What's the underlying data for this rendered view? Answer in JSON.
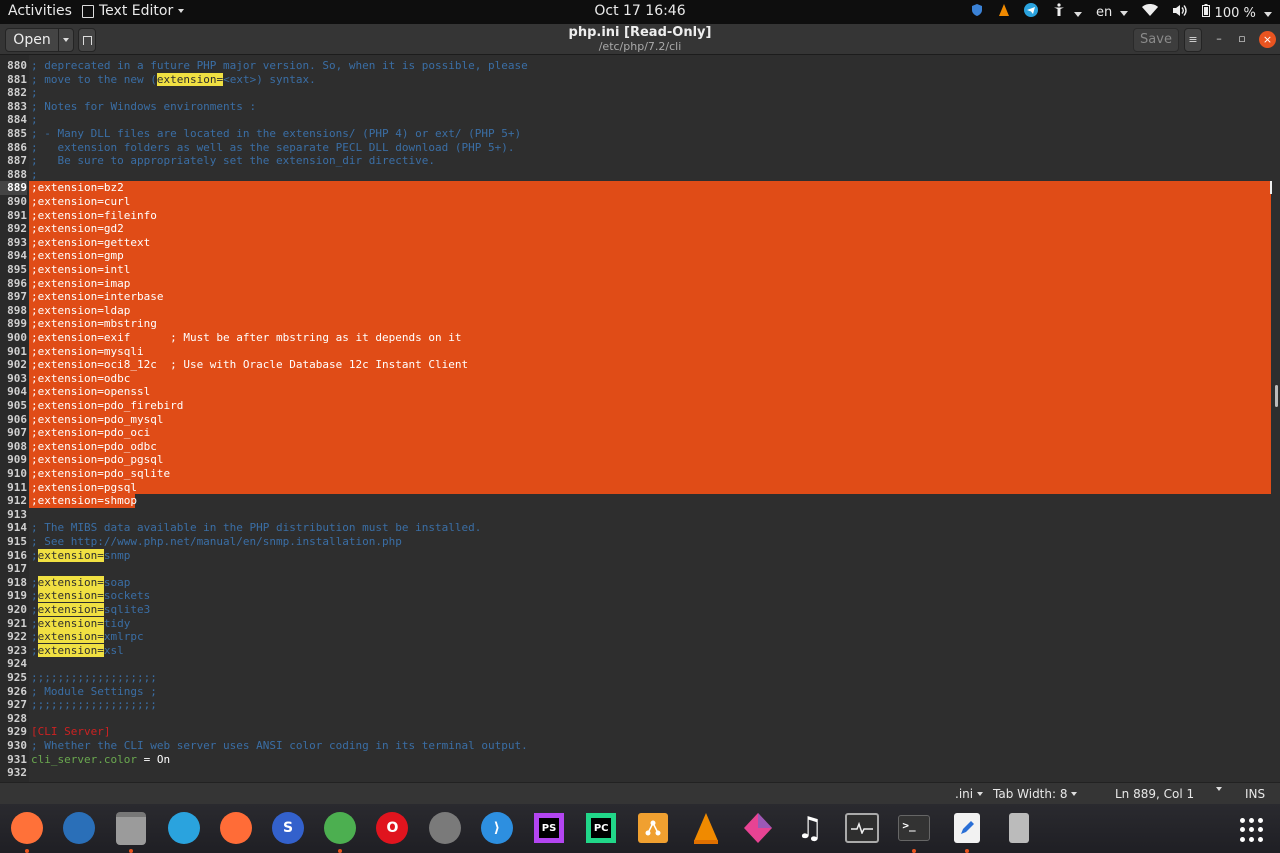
{
  "topbar": {
    "activities": "Activities",
    "app_menu": "Text Editor",
    "clock": "Oct 17  16:46",
    "language": "en",
    "battery": "100 %"
  },
  "header": {
    "open_label": "Open",
    "title": "php.ini [Read-Only]",
    "subtitle": "/etc/php/7.2/cli",
    "save_label": "Save"
  },
  "editor": {
    "lines": [
      {
        "num": "880",
        "parts": [
          {
            "t": "; deprecated in a future PHP major version. So, when it is possible, please"
          }
        ]
      },
      {
        "num": "881",
        "parts": [
          {
            "t": "; move to the new ("
          },
          {
            "t": "extension=",
            "hl": true
          },
          {
            "t": "<ext>) syntax."
          }
        ]
      },
      {
        "num": "882",
        "parts": [
          {
            "t": ";"
          }
        ]
      },
      {
        "num": "883",
        "parts": [
          {
            "t": "; Notes for Windows environments :"
          }
        ]
      },
      {
        "num": "884",
        "parts": [
          {
            "t": ";"
          }
        ]
      },
      {
        "num": "885",
        "parts": [
          {
            "t": "; - Many DLL files are located in the extensions/ (PHP 4) or ext/ (PHP 5+)"
          }
        ]
      },
      {
        "num": "886",
        "parts": [
          {
            "t": ";   extension folders as well as the separate PECL DLL download (PHP 5+)."
          }
        ]
      },
      {
        "num": "887",
        "parts": [
          {
            "t": ";   Be sure to appropriately set the extension_dir directive."
          }
        ]
      },
      {
        "num": "888",
        "parts": [
          {
            "t": ";"
          }
        ]
      },
      {
        "num": "889",
        "sel": true,
        "current": true,
        "parts": [
          {
            "t": ";extension=bz2"
          }
        ]
      },
      {
        "num": "890",
        "sel": true,
        "parts": [
          {
            "t": ";extension=curl"
          }
        ]
      },
      {
        "num": "891",
        "sel": true,
        "parts": [
          {
            "t": ";extension=fileinfo"
          }
        ]
      },
      {
        "num": "892",
        "sel": true,
        "parts": [
          {
            "t": ";extension=gd2"
          }
        ]
      },
      {
        "num": "893",
        "sel": true,
        "parts": [
          {
            "t": ";extension=gettext"
          }
        ]
      },
      {
        "num": "894",
        "sel": true,
        "parts": [
          {
            "t": ";extension=gmp"
          }
        ]
      },
      {
        "num": "895",
        "sel": true,
        "parts": [
          {
            "t": ";extension=intl"
          }
        ]
      },
      {
        "num": "896",
        "sel": true,
        "parts": [
          {
            "t": ";extension=imap"
          }
        ]
      },
      {
        "num": "897",
        "sel": true,
        "parts": [
          {
            "t": ";extension=interbase"
          }
        ]
      },
      {
        "num": "898",
        "sel": true,
        "parts": [
          {
            "t": ";extension=ldap"
          }
        ]
      },
      {
        "num": "899",
        "sel": true,
        "parts": [
          {
            "t": ";extension=mbstring"
          }
        ]
      },
      {
        "num": "900",
        "sel": true,
        "parts": [
          {
            "t": ";extension=exif      ; Must be after mbstring as it depends on it"
          }
        ]
      },
      {
        "num": "901",
        "sel": true,
        "parts": [
          {
            "t": ";extension=mysqli"
          }
        ]
      },
      {
        "num": "902",
        "sel": true,
        "parts": [
          {
            "t": ";extension=oci8_12c  ; Use with Oracle Database 12c Instant Client"
          }
        ]
      },
      {
        "num": "903",
        "sel": true,
        "parts": [
          {
            "t": ";extension=odbc"
          }
        ]
      },
      {
        "num": "904",
        "sel": true,
        "parts": [
          {
            "t": ";extension=openssl"
          }
        ]
      },
      {
        "num": "905",
        "sel": true,
        "parts": [
          {
            "t": ";extension=pdo_firebird"
          }
        ]
      },
      {
        "num": "906",
        "sel": true,
        "parts": [
          {
            "t": ";extension=pdo_mysql"
          }
        ]
      },
      {
        "num": "907",
        "sel": true,
        "parts": [
          {
            "t": ";extension=pdo_oci"
          }
        ]
      },
      {
        "num": "908",
        "sel": true,
        "parts": [
          {
            "t": ";extension=pdo_odbc"
          }
        ]
      },
      {
        "num": "909",
        "sel": true,
        "parts": [
          {
            "t": ";extension=pdo_pgsql"
          }
        ]
      },
      {
        "num": "910",
        "sel": true,
        "parts": [
          {
            "t": ";extension=pdo_sqlite"
          }
        ]
      },
      {
        "num": "911",
        "sel": true,
        "parts": [
          {
            "t": ";extension=pgsql"
          }
        ]
      },
      {
        "num": "912",
        "sel": true,
        "parts": [
          {
            "t": ";extension=shmop"
          }
        ]
      },
      {
        "num": "913",
        "parts": [
          {
            "t": ""
          }
        ]
      },
      {
        "num": "914",
        "parts": [
          {
            "t": "; The MIBS data available in the PHP distribution must be installed."
          }
        ]
      },
      {
        "num": "915",
        "parts": [
          {
            "t": "; See http://www.php.net/manual/en/snmp.installation.php"
          }
        ]
      },
      {
        "num": "916",
        "parts": [
          {
            "t": ";"
          },
          {
            "t": "extension=",
            "hl": true
          },
          {
            "t": "snmp"
          }
        ]
      },
      {
        "num": "917",
        "parts": [
          {
            "t": ""
          }
        ]
      },
      {
        "num": "918",
        "parts": [
          {
            "t": ";"
          },
          {
            "t": "extension=",
            "hl": true
          },
          {
            "t": "soap"
          }
        ]
      },
      {
        "num": "919",
        "parts": [
          {
            "t": ";"
          },
          {
            "t": "extension=",
            "hl": true
          },
          {
            "t": "sockets"
          }
        ]
      },
      {
        "num": "920",
        "parts": [
          {
            "t": ";"
          },
          {
            "t": "extension=",
            "hl": true
          },
          {
            "t": "sqlite3"
          }
        ]
      },
      {
        "num": "921",
        "parts": [
          {
            "t": ";"
          },
          {
            "t": "extension=",
            "hl": true
          },
          {
            "t": "tidy"
          }
        ]
      },
      {
        "num": "922",
        "parts": [
          {
            "t": ";"
          },
          {
            "t": "extension=",
            "hl": true
          },
          {
            "t": "xmlrpc"
          }
        ]
      },
      {
        "num": "923",
        "parts": [
          {
            "t": ";"
          },
          {
            "t": "extension=",
            "hl": true
          },
          {
            "t": "xsl"
          }
        ]
      },
      {
        "num": "924",
        "parts": [
          {
            "t": ""
          }
        ]
      },
      {
        "num": "925",
        "parts": [
          {
            "t": ";;;;;;;;;;;;;;;;;;;"
          }
        ]
      },
      {
        "num": "926",
        "parts": [
          {
            "t": "; Module Settings ;"
          }
        ]
      },
      {
        "num": "927",
        "parts": [
          {
            "t": ";;;;;;;;;;;;;;;;;;;"
          }
        ]
      },
      {
        "num": "928",
        "parts": [
          {
            "t": ""
          }
        ]
      },
      {
        "num": "929",
        "kind": "section",
        "parts": [
          {
            "t": "[CLI Server]"
          }
        ]
      },
      {
        "num": "930",
        "parts": [
          {
            "t": "; Whether the CLI web server uses ANSI color coding in its terminal output."
          }
        ]
      },
      {
        "num": "931",
        "kind": "key",
        "parts": [
          {
            "t": "cli_server.color"
          },
          {
            "t": " = On",
            "val": true
          }
        ]
      },
      {
        "num": "932",
        "parts": [
          {
            "t": ""
          }
        ]
      }
    ]
  },
  "statusbar": {
    "language": ".ini",
    "tab_width": "Tab Width: 8",
    "position": "Ln 889, Col 1",
    "mode": "INS"
  },
  "dock": {
    "apps": [
      {
        "name": "firefox-icon",
        "color": "#ff7139",
        "running": true
      },
      {
        "name": "thunderbird-icon",
        "color": "#2a6fb8",
        "running": false
      },
      {
        "name": "files-icon",
        "color": "#9b9b9b",
        "running": true
      },
      {
        "name": "telegram-icon",
        "color": "#2aa3de",
        "running": false
      },
      {
        "name": "postman-icon",
        "color": "#ff6c37",
        "running": false
      },
      {
        "name": "simplenote-icon",
        "color": "#3361cc",
        "running": false
      },
      {
        "name": "chrome-icon",
        "color": "#4caf50",
        "running": true
      },
      {
        "name": "opera-icon",
        "color": "#e0141e",
        "running": false
      },
      {
        "name": "settings-icon",
        "color": "#7a7a7a",
        "running": false
      },
      {
        "name": "vscode-icon",
        "color": "#2d8fe0",
        "running": false
      },
      {
        "name": "phpstorm-icon",
        "color": "#b345f1",
        "running": false
      },
      {
        "name": "pycharm-icon",
        "color": "#21d789",
        "running": false
      },
      {
        "name": "gitkraken-icon",
        "color": "#f0a030",
        "running": false
      },
      {
        "name": "vlc-icon",
        "color": "#f08a00",
        "running": false
      },
      {
        "name": "kite-icon",
        "color": "#e84393",
        "running": false
      },
      {
        "name": "music-icon",
        "color": "#ffffff",
        "running": false
      },
      {
        "name": "system-monitor-icon",
        "color": "#555555",
        "running": false
      },
      {
        "name": "terminal-icon",
        "color": "#3a3a3a",
        "running": true
      },
      {
        "name": "text-editor-icon",
        "color": "#f2f2f2",
        "running": true
      },
      {
        "name": "usb-drive-icon",
        "color": "#bbbbbb",
        "running": false
      }
    ]
  }
}
